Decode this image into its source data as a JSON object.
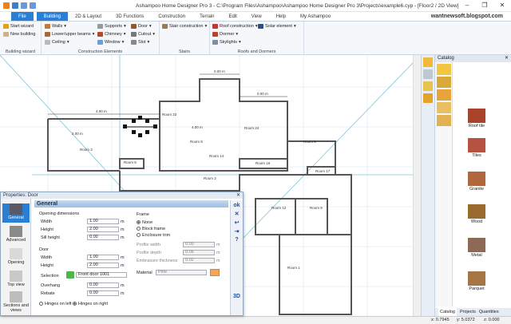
{
  "window": {
    "title": "Ashampoo Home Designer Pro 3 - C:\\Program Files\\Ashampoo\\Ashampoo Home Designer Pro 3\\Projects\\example6.cyp - [Floor2 / 2D View]",
    "controls": [
      "–",
      "❐",
      "✕"
    ]
  },
  "watermark": "wantnewsoft.blogspot.com",
  "tabs": [
    "File",
    "Building",
    "2D & Layout",
    "3D Functions",
    "Construction",
    "Terrain",
    "Edit",
    "View",
    "Help",
    "My Ashampoo"
  ],
  "ribbon": {
    "building_wizard": {
      "label": "Building wizard",
      "items": [
        "Start wizard",
        "New building"
      ]
    },
    "construction_elements": {
      "label": "Construction Elements",
      "col1": [
        "Walls",
        "Lower/upper beams",
        "Ceiling"
      ],
      "col2": [
        "Supports",
        "Chimney",
        "Window"
      ],
      "col3": [
        "Door",
        "Cutout",
        "Slot"
      ]
    },
    "stairs": {
      "label": "Stairs",
      "items": [
        "Stair construction"
      ]
    },
    "roofs": {
      "label": "Roofs and Dormers",
      "col1": [
        "Roof construction",
        "Dormer",
        "Skylights"
      ],
      "col2": [
        "Solar element"
      ]
    }
  },
  "plan": {
    "rooms": [
      "Room 22",
      "Room 24",
      "Room 8",
      "Room 3",
      "Room 6",
      "Room 5",
      "Room 2",
      "Room 16",
      "Room 14",
      "Room 17",
      "Room 9",
      "Room 12",
      "Room 1"
    ],
    "dims": [
      "4.00 m",
      "0.00 m",
      "0.00 m",
      "2.00 m",
      "4.00 m"
    ]
  },
  "catalog": {
    "title": "Catalog",
    "items": [
      "Roof tile",
      "Tiles",
      "Granite",
      "Wood",
      "Metal",
      "Parquet"
    ],
    "tabs": [
      "Catalog",
      "Projects",
      "Quantities"
    ]
  },
  "status": {
    "x": "x: 0.7945",
    "y": "y: 5.0372",
    "z": "z: 0.000"
  },
  "properties": {
    "title": "Properties: Door",
    "nav": [
      "General",
      "Advanced",
      "Opening",
      "Top view",
      "Sections and views"
    ],
    "section_title": "General",
    "opening": {
      "label": "Opening dimensions",
      "width_label": "Width",
      "width": "1.00",
      "height_label": "Height",
      "height": "2.00",
      "sill_label": "Sill height",
      "sill": "0.00"
    },
    "door": {
      "label": "Door",
      "width_label": "Width",
      "width": "1.00",
      "height_label": "Height",
      "height": "2.00",
      "selection_label": "Selection",
      "selection": "Front door 1001",
      "overhang_label": "Overhang",
      "overhang": "0.00",
      "rebate_label": "Rebate",
      "rebate": "0.00"
    },
    "unit": "m",
    "hinges": {
      "left": "Hinges on left",
      "right": "Hinges on right"
    },
    "frame": {
      "label": "Frame",
      "options": [
        "None",
        "Block frame",
        "Enclosure trim"
      ],
      "profile_width_label": "Profile width",
      "profile_width": "0.00",
      "profile_depth_label": "Profile depth",
      "profile_depth": "0.06",
      "embrasure_label": "Embrasure thickness",
      "embrasure": "0.02",
      "material_label": "Material",
      "material": "Pine"
    },
    "side_buttons": [
      "ok",
      "✕",
      "↩",
      "⇥",
      "?",
      "3D"
    ]
  }
}
